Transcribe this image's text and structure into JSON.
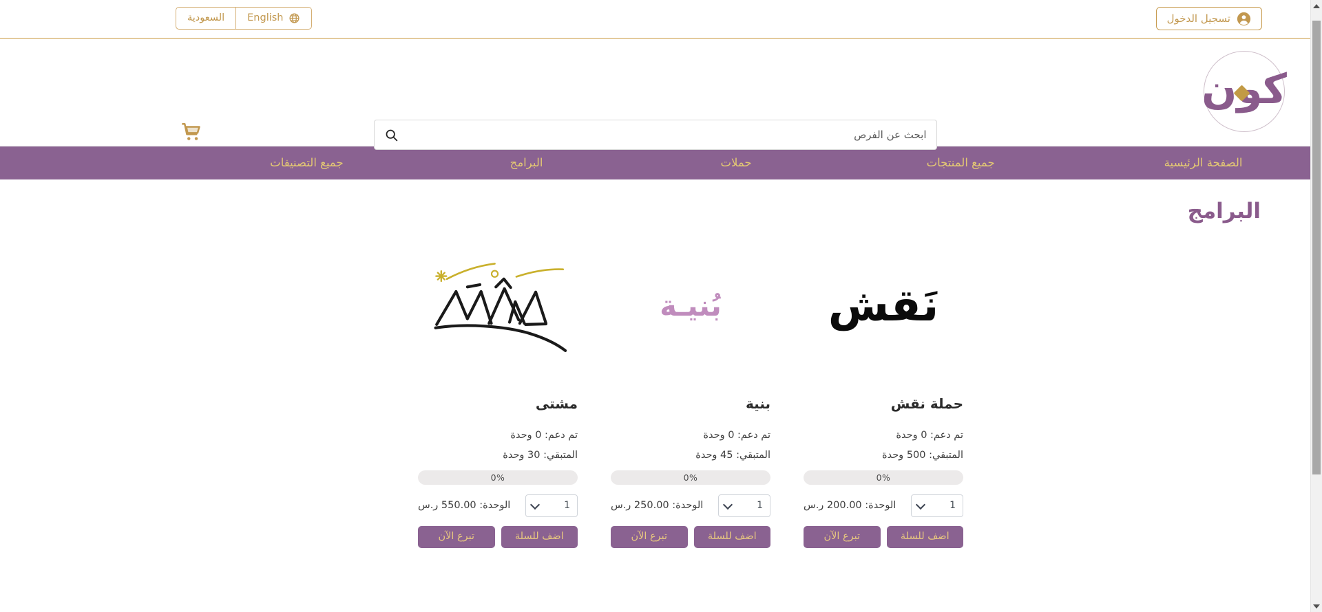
{
  "colors": {
    "gold": "#c2984f",
    "gold_light": "#e3c873",
    "purple": "#8a6291",
    "purple_dark": "#8a5b8c",
    "nav_bg": "#8a6291",
    "progress_track": "#eceaea"
  },
  "topbar": {
    "language_switch": {
      "globe_icon": "globe-icon",
      "active_label": "English",
      "alt_label": "السعودية"
    },
    "login": {
      "label": "تسجيل الدخول",
      "icon": "user-account-icon"
    }
  },
  "header": {
    "logo": {
      "wordmark": "كون",
      "alt": "كون"
    },
    "search": {
      "placeholder": "ابحث عن الفرص",
      "value": "",
      "icon": "search-icon"
    },
    "cart": {
      "icon": "shopping-cart-icon"
    }
  },
  "nav": {
    "items": [
      {
        "label": "الصفحة الرئيسية",
        "name": "nav-home"
      },
      {
        "label": "جميع المنتجات",
        "name": "nav-all-products"
      },
      {
        "label": "حملات",
        "name": "nav-campaigns"
      },
      {
        "label": "البرامج",
        "name": "nav-programs"
      },
      {
        "label": "جميع التصنيفات",
        "name": "nav-all-categories"
      }
    ]
  },
  "main": {
    "page_title": "البرامج",
    "labels": {
      "supported_prefix": "تم دعم:",
      "remaining_prefix": "المتبقي:",
      "unit_prefix": "الوحدة:",
      "unit_word": "وحدة",
      "currency": "ر.س",
      "donate_now": "تبرع الآن",
      "add_to_cart": "اضف للسلة"
    },
    "cards": [
      {
        "id": "mashta",
        "image_kind": "tents-sketch",
        "title": "مشتى",
        "supported_text": "تم دعم: 0 وحدة",
        "remaining_text": "المتبقي: 30 وحدة",
        "progress_label": "0%",
        "progress_value": 0,
        "price_text": "الوحدة: 550.00 ر.س",
        "quantity": "1",
        "donate_label": "تبرع الآن",
        "cart_label": "اضف للسلة"
      },
      {
        "id": "bunya",
        "image_kind": "bunya-wordmark",
        "image_text": "بُنيـة",
        "title": "بنية",
        "supported_text": "تم دعم: 0 وحدة",
        "remaining_text": "المتبقي: 45 وحدة",
        "progress_label": "0%",
        "progress_value": 0,
        "price_text": "الوحدة: 250.00 ر.س",
        "quantity": "1",
        "donate_label": "تبرع الآن",
        "cart_label": "اضف للسلة"
      },
      {
        "id": "naqsh",
        "image_kind": "naqsh-wordmark",
        "image_text": "نَقش",
        "title": "حملة نقش",
        "supported_text": "تم دعم: 0 وحدة",
        "remaining_text": "المتبقي: 500 وحدة",
        "progress_label": "0%",
        "progress_value": 0,
        "price_text": "الوحدة: 200.00 ر.س",
        "quantity": "1",
        "donate_label": "تبرع الآن",
        "cart_label": "اضف للسلة"
      }
    ]
  }
}
